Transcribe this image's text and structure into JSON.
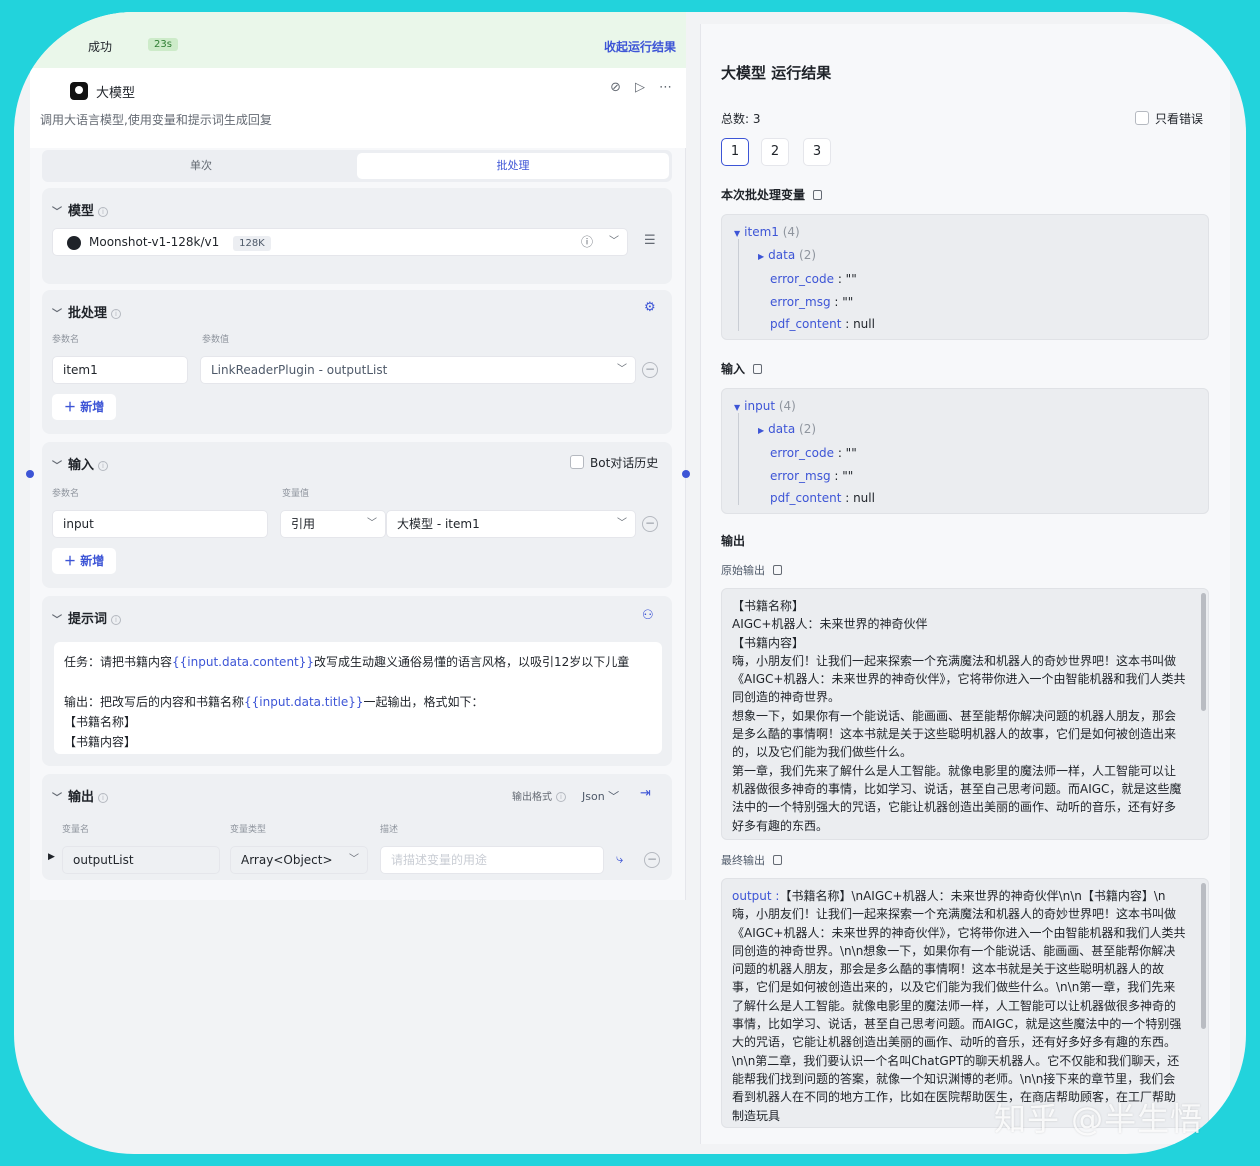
{
  "run_status": {
    "text": "成功",
    "time": "23s",
    "collapse": "收起运行结果"
  },
  "node": {
    "title": "大模型",
    "desc": "调用大语言模型,使用变量和提示词生成回复"
  },
  "tabs": {
    "single": "单次",
    "batch": "批处理"
  },
  "model": {
    "title": "模型",
    "name": "Moonshot-v1-128k/v1",
    "badge": "128K"
  },
  "batch": {
    "title": "批处理",
    "param_name_label": "参数名",
    "param_value_label": "参数值",
    "item_name": "item1",
    "item_value": "LinkReaderPlugin - outputList",
    "add": "新增"
  },
  "input": {
    "title": "输入",
    "history_label": "Bot对话历史",
    "param_name_label": "参数名",
    "var_value_label": "变量值",
    "name": "input",
    "ref_type": "引用",
    "ref_value": "大模型 - item1",
    "add": "新增"
  },
  "prompt": {
    "title": "提示词",
    "line1_pre": "任务：请把书籍内容",
    "line1_var": "{{input.data.content}}",
    "line1_post": "改写成生动趣义通俗易懂的语言风格，以吸引12岁以下儿童",
    "line2_pre": "输出：把改写后的内容和书籍名称",
    "line2_var": "{{input.data.title}}",
    "line2_post": "一起输出，格式如下：",
    "line3": "【书籍名称】",
    "line4": "【书籍内容】"
  },
  "output": {
    "title": "输出",
    "format_label": "输出格式",
    "format_value": "Json",
    "var_name_label": "变量名",
    "var_type_label": "变量类型",
    "desc_label": "描述",
    "var_name": "outputList",
    "var_type": "Array<Object>",
    "desc_placeholder": "请描述变量的用途"
  },
  "result": {
    "title": "大模型 运行结果",
    "total": "总数: 3",
    "only_errors": "只看错误",
    "pages": [
      "1",
      "2",
      "3"
    ],
    "batch_vars_label": "本次批处理变量",
    "batch_tree": {
      "root": "item1",
      "root_count": "(4)",
      "data": "data",
      "data_count": "(2)",
      "k1": "error_code",
      "v1": "\"\"",
      "k2": "error_msg",
      "v2": "\"\"",
      "k3": "pdf_content",
      "v3": "null"
    },
    "input_label": "输入",
    "input_tree": {
      "root": "input",
      "root_count": "(4)",
      "data": "data",
      "data_count": "(2)",
      "k1": "error_code",
      "v1": "\"\"",
      "k2": "error_msg",
      "v2": "\"\"",
      "k3": "pdf_content",
      "v3": "null"
    },
    "output_label": "输出",
    "raw_output_label": "原始输出",
    "raw_output": "【书籍名称】\nAIGC+机器人：未来世界的神奇伙伴\n【书籍内容】\n嗨，小朋友们！让我们一起来探索一个充满魔法和机器人的奇妙世界吧！这本书叫做《AIGC+机器人：未来世界的神奇伙伴》，它将带你进入一个由智能机器和我们人类共同创造的神奇世界。\n想象一下，如果你有一个能说话、能画画、甚至能帮你解决问题的机器人朋友，那会是多么酷的事情啊！这本书就是关于这些聪明机器人的故事，它们是如何被创造出来的，以及它们能为我们做些什么。\n第一章，我们先来了解什么是人工智能。就像电影里的魔法师一样，人工智能可以让机器做很多神奇的事情，比如学习、说话，甚至自己思考问题。而AIGC，就是这些魔法中的一个特别强大的咒语，它能让机器创造出美丽的画作、动听的音乐，还有好多好多有趣的东西。",
    "final_output_label": "最终输出",
    "final_output_key": "output :",
    "final_output": "【书籍名称】\\nAIGC+机器人：未来世界的神奇伙伴\\n\\n【书籍内容】\\n嗨，小朋友们！让我们一起来探索一个充满魔法和机器人的奇妙世界吧！这本书叫做《AIGC+机器人：未来世界的神奇伙伴》，它将带你进入一个由智能机器和我们人类共同创造的神奇世界。\\n\\n想象一下，如果你有一个能说话、能画画、甚至能帮你解决问题的机器人朋友，那会是多么酷的事情啊！这本书就是关于这些聪明机器人的故事，它们是如何被创造出来的，以及它们能为我们做些什么。\\n\\n第一章，我们先来了解什么是人工智能。就像电影里的魔法师一样，人工智能可以让机器做很多神奇的事情，比如学习、说话，甚至自己思考问题。而AIGC，就是这些魔法中的一个特别强大的咒语，它能让机器创造出美丽的画作、动听的音乐，还有好多好多有趣的东西。\\n\\n第二章，我们要认识一个名叫ChatGPT的聊天机器人。它不仅能和我们聊天，还能帮我们找到问题的答案，就像一个知识渊博的老师。\\n\\n接下来的章节里，我们会看到机器人在不同的地方工作，比如在医院帮助医生，在商店帮助顾客，在工厂帮助制造玩具"
  },
  "watermark": "知乎 @半生悟"
}
